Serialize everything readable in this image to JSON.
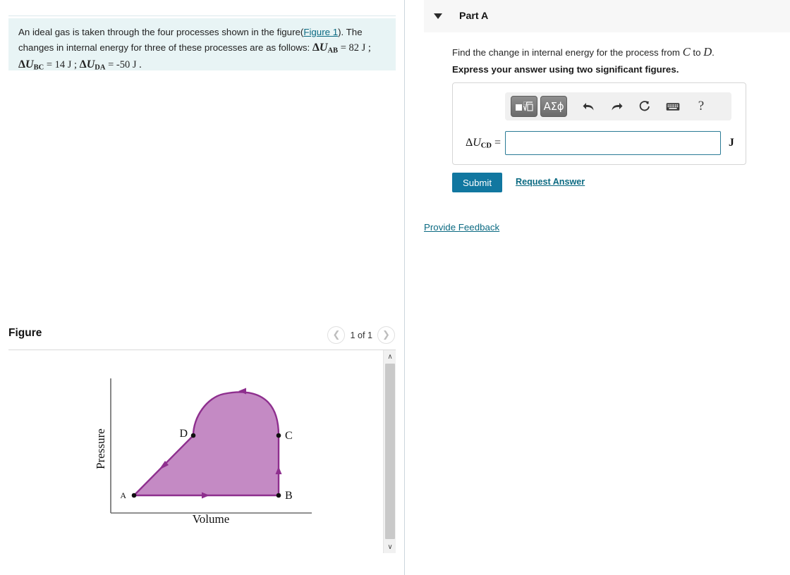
{
  "question": {
    "text_part1": "An ideal gas is taken through the four processes shown in the figure(",
    "figure_link": "Figure 1",
    "text_part2": "). The changes in internal energy for three of these processes are as follows: ",
    "delta_ab": "ΔU",
    "sub_ab": "AB",
    "val_ab": " = 82 J ; ",
    "delta_bc": "ΔU",
    "sub_bc": "BC",
    "val_bc": " = 14 J ; ",
    "delta_da": "ΔU",
    "sub_da": "DA",
    "val_da": " = -50 J ."
  },
  "figure": {
    "title": "Figure",
    "pager_label": "1 of 1",
    "prev_icon": "chevron-left",
    "next_icon": "chevron-right",
    "scroll_up_icon": "∧",
    "scroll_down_icon": "∨"
  },
  "chart_data": {
    "type": "line",
    "title": "",
    "xlabel": "Volume",
    "ylabel": "Pressure",
    "grid": false,
    "legend": "none",
    "annotations": [
      "A",
      "B",
      "C",
      "D"
    ],
    "points": [
      {
        "label": "A",
        "x": 0.08,
        "y": 0.08
      },
      {
        "label": "B",
        "x": 0.82,
        "y": 0.08
      },
      {
        "label": "C",
        "x": 0.82,
        "y": 0.55
      },
      {
        "label": "D",
        "x": 0.47,
        "y": 0.55
      }
    ],
    "processes": [
      {
        "name": "A to B",
        "type": "horizontal-isobaric",
        "direction": "right"
      },
      {
        "name": "B to C",
        "type": "vertical-isochoric",
        "direction": "up"
      },
      {
        "name": "C to D",
        "type": "curved-arc",
        "direction": "left"
      },
      {
        "name": "D to A",
        "type": "straight-diagonal",
        "direction": "down-left"
      }
    ],
    "fill_color": "#c48ac4",
    "line_color": "#8e2f8e"
  },
  "part": {
    "title": "Part A",
    "caret_icon": "caret-down-icon",
    "prompt_pre": "Find the change in internal energy for the process from ",
    "prompt_c": "C",
    "prompt_mid": " to ",
    "prompt_d": "D",
    "prompt_post": ".",
    "express": "Express your answer using two significant figures."
  },
  "toolbar": {
    "template_button": "template-math-icon",
    "greek_button": "ΑΣϕ",
    "undo_icon": "⮌",
    "redo_icon": "⮍",
    "reset_icon": "↻",
    "keyboard_icon": "keyboard-icon",
    "help_icon": "?"
  },
  "answer": {
    "label_delta": "ΔU",
    "label_sub": "CD",
    "label_eq": " =",
    "value": "",
    "placeholder": "",
    "unit": "J"
  },
  "actions": {
    "submit": "Submit",
    "request_answer": "Request Answer",
    "provide_feedback": "Provide Feedback"
  },
  "colors": {
    "accent": "#1177a0",
    "link": "#0b6a82",
    "question_bg": "#e8f4f5",
    "part_header_bg": "#f7f7f7"
  }
}
